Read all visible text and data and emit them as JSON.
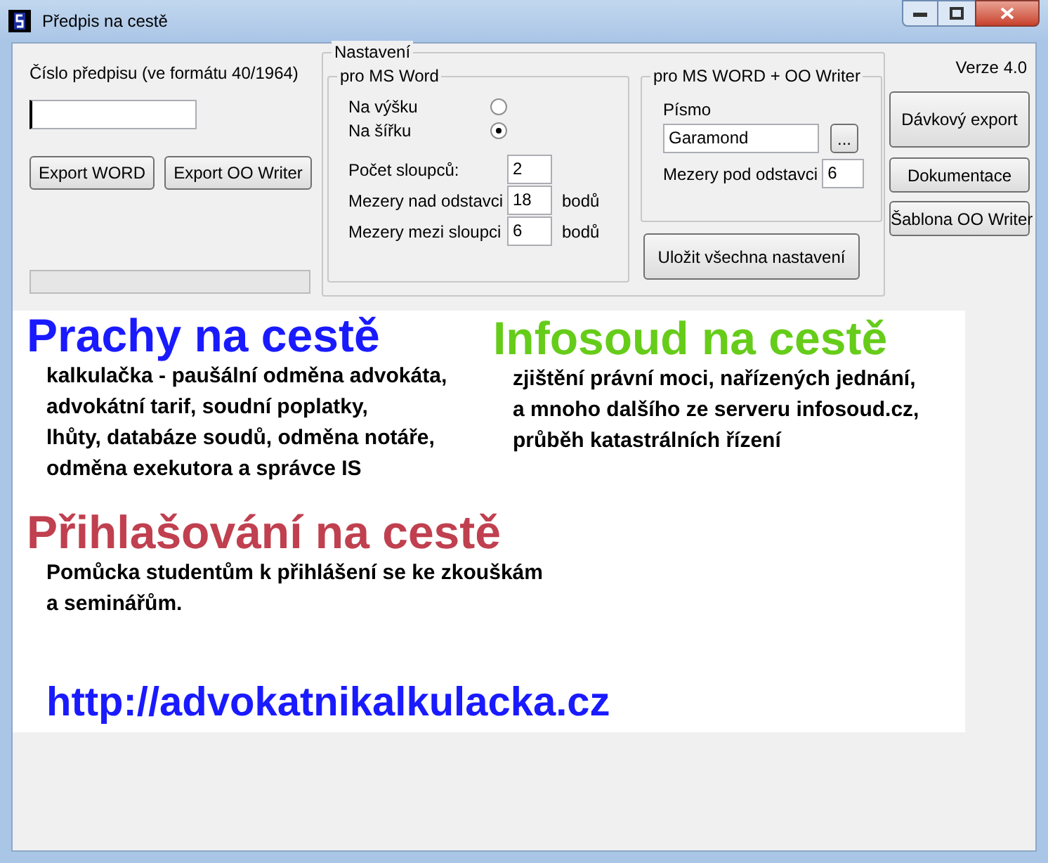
{
  "window": {
    "title": "Předpis na cestě"
  },
  "left": {
    "label": "Číslo předpisu (ve formátu 40/1964)",
    "buttons": [
      "Export WORD",
      "Export OO Writer"
    ],
    "progress": {
      "level": 0
    }
  },
  "settings": {
    "title": "Nastavení",
    "word": {
      "title": "pro MS Word",
      "orientation": [
        {
          "label": "Na výšku",
          "selected": false
        },
        {
          "label": "Na šířku",
          "selected": true
        }
      ],
      "fields": [
        {
          "label": "Počet sloupců:",
          "value": "2"
        },
        {
          "label": "Mezery nad odstavci",
          "value": "18",
          "unit": "bodů"
        },
        {
          "label": "Mezery mezi sloupci",
          "value": "6",
          "unit": "bodů"
        }
      ]
    },
    "both": {
      "title": "pro MS WORD + OO Writer",
      "font_label": "Písmo",
      "font_value": "Garamond",
      "browse": "...",
      "spacing_label": "Mezery pod odstavci",
      "spacing_value": "6"
    },
    "save": "Uložit všechna nastavení"
  },
  "right": {
    "version": "Verze 4.0",
    "buttons": [
      "Dávkový export",
      "Dokumentace",
      "Šablona OO Writer"
    ]
  },
  "ads": [
    {
      "title": "Prachy na cestě",
      "color": "#1a1aff",
      "lines": [
        "kalkulačka - paušální odměna advokáta,",
        "advokátní tarif, soudní poplatky,",
        "lhůty, databáze soudů, odměna notáře,",
        "odměna exekutora a správce IS"
      ]
    },
    {
      "title": "Infosoud na cestě",
      "color": "#66cc1a",
      "lines": [
        "zjištění právní moci, nařízených jednání,",
        "a mnoho dalšího ze serveru infosoud.cz,",
        "průběh katastrálních řízení"
      ]
    },
    {
      "title": "Přihlašování na cestě",
      "color": "#c0404f",
      "lines": [
        "Pomůcka studentům k přihlášení se ke zkouškám",
        "a seminářům."
      ]
    }
  ],
  "url": "http://advokatnikalkulacka.cz"
}
